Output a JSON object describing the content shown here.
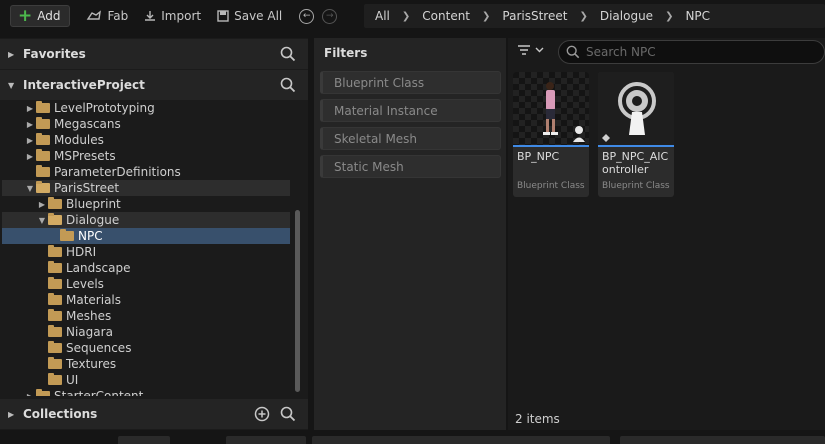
{
  "toolbar": {
    "add_label": "Add",
    "fab_label": "Fab",
    "import_label": "Import",
    "save_all_label": "Save All"
  },
  "breadcrumb": [
    "All",
    "Content",
    "ParisStreet",
    "Dialogue",
    "NPC"
  ],
  "left_panel": {
    "favorites_label": "Favorites",
    "project_label": "InteractiveProject",
    "collections_label": "Collections",
    "tree": [
      {
        "label": "LevelPrototyping",
        "depth": 1,
        "expand": "collapsed",
        "state": ""
      },
      {
        "label": "Megascans",
        "depth": 1,
        "expand": "collapsed",
        "state": ""
      },
      {
        "label": "Modules",
        "depth": 1,
        "expand": "collapsed",
        "state": ""
      },
      {
        "label": "MSPresets",
        "depth": 1,
        "expand": "collapsed",
        "state": ""
      },
      {
        "label": "ParameterDefinitions",
        "depth": 1,
        "expand": "none",
        "state": ""
      },
      {
        "label": "ParisStreet",
        "depth": 1,
        "expand": "expanded",
        "state": "parent"
      },
      {
        "label": "Blueprint",
        "depth": 2,
        "expand": "collapsed",
        "state": ""
      },
      {
        "label": "Dialogue",
        "depth": 2,
        "expand": "expanded",
        "state": "parent"
      },
      {
        "label": "NPC",
        "depth": 3,
        "expand": "none",
        "state": "selected"
      },
      {
        "label": "HDRI",
        "depth": 2,
        "expand": "none",
        "state": ""
      },
      {
        "label": "Landscape",
        "depth": 2,
        "expand": "none",
        "state": ""
      },
      {
        "label": "Levels",
        "depth": 2,
        "expand": "none",
        "state": ""
      },
      {
        "label": "Materials",
        "depth": 2,
        "expand": "none",
        "state": ""
      },
      {
        "label": "Meshes",
        "depth": 2,
        "expand": "none",
        "state": ""
      },
      {
        "label": "Niagara",
        "depth": 2,
        "expand": "none",
        "state": ""
      },
      {
        "label": "Sequences",
        "depth": 2,
        "expand": "none",
        "state": ""
      },
      {
        "label": "Textures",
        "depth": 2,
        "expand": "none",
        "state": ""
      },
      {
        "label": "UI",
        "depth": 2,
        "expand": "none",
        "state": ""
      },
      {
        "label": "StarterContent",
        "depth": 1,
        "expand": "collapsed",
        "state": ""
      }
    ]
  },
  "filters": {
    "title": "Filters",
    "items": [
      "Blueprint Class",
      "Material Instance",
      "Skeletal Mesh",
      "Static Mesh"
    ]
  },
  "content": {
    "search_placeholder": "Search NPC",
    "assets": [
      {
        "name": "BP_NPC",
        "type": "Blueprint Class"
      },
      {
        "name": "BP_NPC_AIController",
        "type": "Blueprint Class"
      }
    ],
    "items_count": "2 items"
  },
  "colors": {
    "accent": "#3f8ae6",
    "add_green": "#4cb84c",
    "folder": "#c29a55",
    "selection": "#38506c"
  }
}
